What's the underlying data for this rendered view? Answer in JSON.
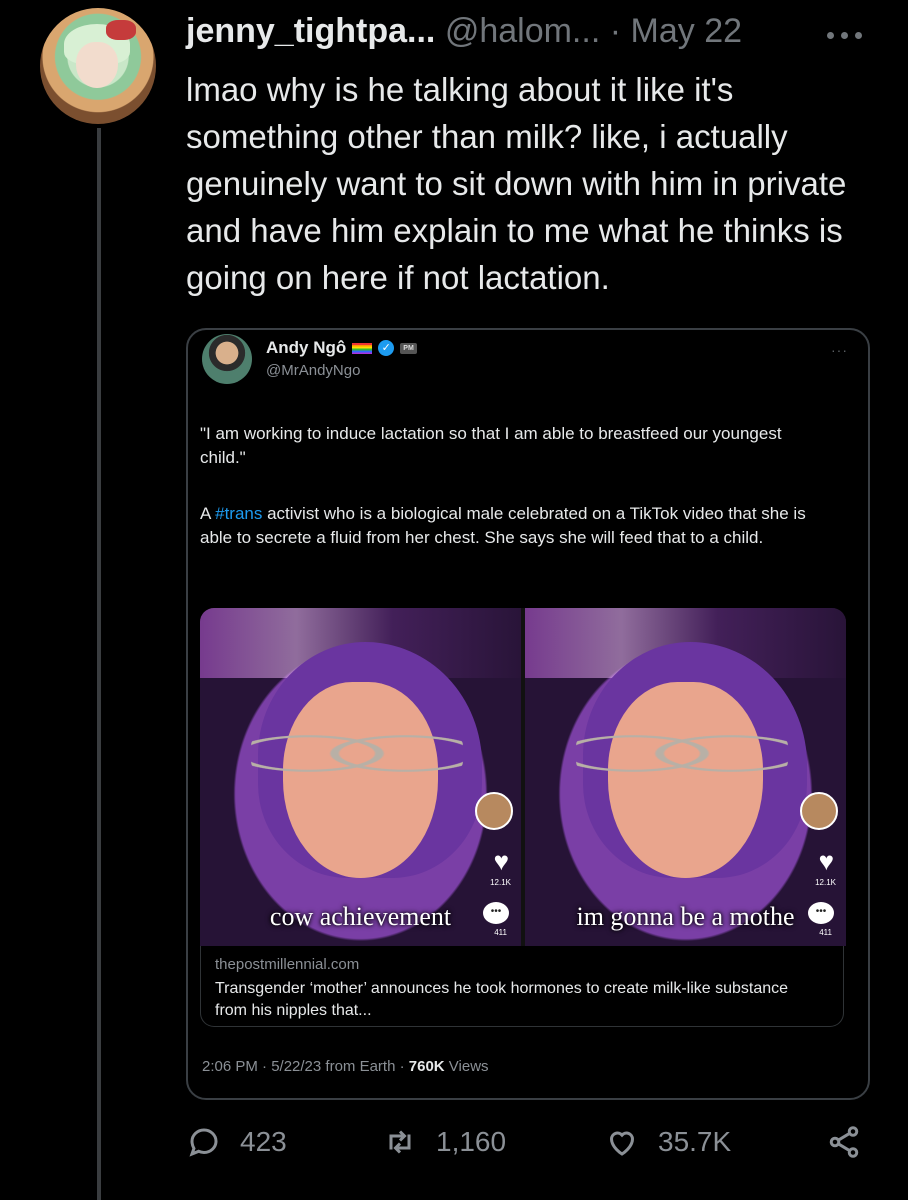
{
  "tweet": {
    "display_name": "jenny_tightpa...",
    "handle": "@halom...",
    "separator": "·",
    "date": "May 22",
    "text": "lmao why is he talking about it like it's something other than milk? like, i actually genuinely want to sit down with him in private and have him explain to me what he thinks is going on here if not lactation."
  },
  "quote": {
    "display_name": "Andy Ngô",
    "badge": "PM",
    "handle": "@MrAndyNgo",
    "more": "···",
    "paragraph1": "\"I am working to induce lactation so that I am able to breastfeed our youngest child.\"",
    "paragraph2_prefix": "A ",
    "paragraph2_hashtag": "#trans",
    "paragraph2_rest": " activist who is a biological male celebrated on a TikTok video that she is able to secrete a fluid from her chest. She says she will feed that to a child.",
    "media": [
      {
        "caption": "cow achievement",
        "like_count": "12.1K",
        "comment_count": "411"
      },
      {
        "caption": "im gonna be a mothe",
        "like_count": "12.1K",
        "comment_count": "411"
      }
    ],
    "card_domain": "thepostmillennial.com",
    "card_title": "Transgender ‘mother’ announces he took hormones to create milk-like substance from his nipples that...",
    "meta_time": "2:06 PM · 5/22/23 from Earth · ",
    "meta_views_count": "760K",
    "meta_views_label": " Views"
  },
  "actions": {
    "replies": "423",
    "retweets": "1,160",
    "likes": "35.7K"
  },
  "icons": {
    "reply": "reply-icon",
    "retweet": "retweet-icon",
    "like": "heart-icon",
    "share": "share-icon",
    "more": "more-icon",
    "verified": "verified-icon",
    "flag": "rainbow-flag-icon"
  },
  "colors": {
    "background": "#000000",
    "text": "#e7e9ea",
    "muted": "#71767b",
    "link": "#1d9bf0",
    "border": "#3a3f44"
  }
}
